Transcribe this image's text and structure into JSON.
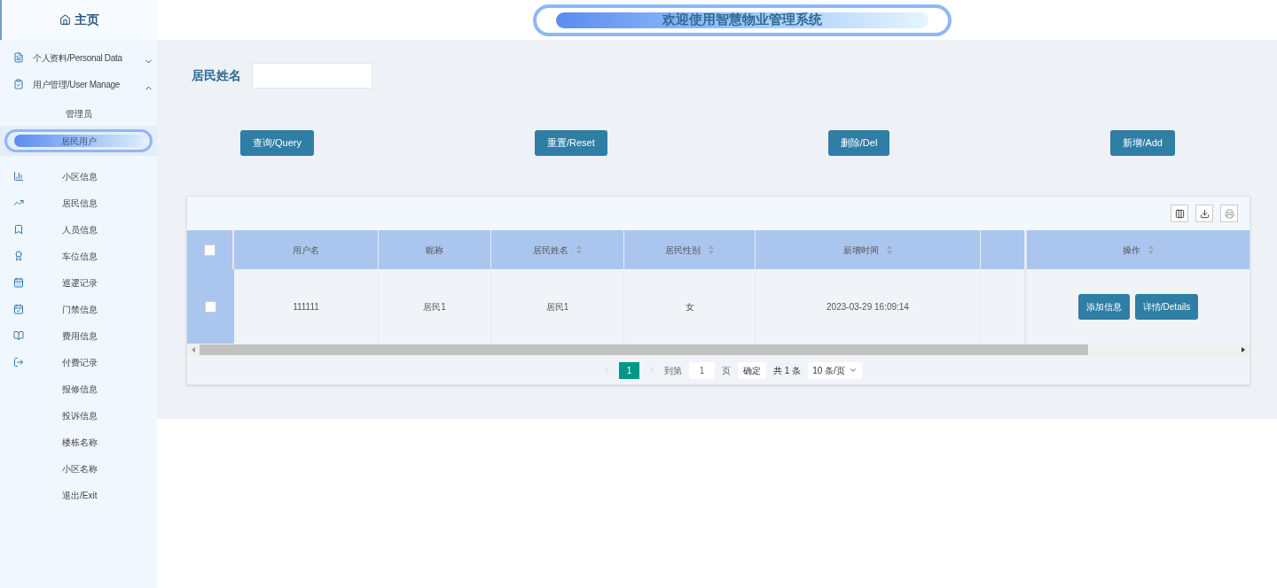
{
  "sidebar": {
    "home": "主页",
    "groups": [
      {
        "label": "个人资料/Personal Data",
        "expanded": false
      },
      {
        "label": "用户管理/User Manage",
        "expanded": true,
        "children": [
          {
            "label": "管理员",
            "selected": false
          },
          {
            "label": "居民用户",
            "selected": true
          }
        ]
      }
    ],
    "items": [
      "小区信息",
      "居民信息",
      "人员信息",
      "车位信息",
      "巡逻记录",
      "门禁信息",
      "费用信息",
      "付费记录",
      "报修信息",
      "投诉信息",
      "楼栋名称",
      "小区名称",
      "退出/Exit"
    ]
  },
  "header": {
    "title": "欢迎使用智慧物业管理系统"
  },
  "search": {
    "label": "居民姓名"
  },
  "buttons": [
    "查询/Query",
    "重置/Reset",
    "删除/Del",
    "新增/Add"
  ],
  "table": {
    "columns": [
      {
        "label": "用户名",
        "sortable": false
      },
      {
        "label": "昵称",
        "sortable": false
      },
      {
        "label": "居民姓名",
        "sortable": true
      },
      {
        "label": "居民性别",
        "sortable": true
      },
      {
        "label": "新增时间",
        "sortable": true
      },
      {
        "sortable": false
      }
    ],
    "all_checked": false,
    "action_column": "操作",
    "rows": [
      {
        "checked": false,
        "cells": [
          "111111",
          "居民1",
          "居民1",
          "女",
          "2023-03-29 16:09:14",
          ""
        ],
        "actions": [
          "添加信息",
          "详情/Details"
        ]
      }
    ]
  },
  "pager": {
    "pages": [
      {
        "label": "1",
        "selected": true
      }
    ],
    "goto_prefix": "到第",
    "goto_value": "1",
    "goto_suffix": "页",
    "confirm": "确定",
    "total": "共 1 条",
    "page_size": "10 条/页"
  }
}
